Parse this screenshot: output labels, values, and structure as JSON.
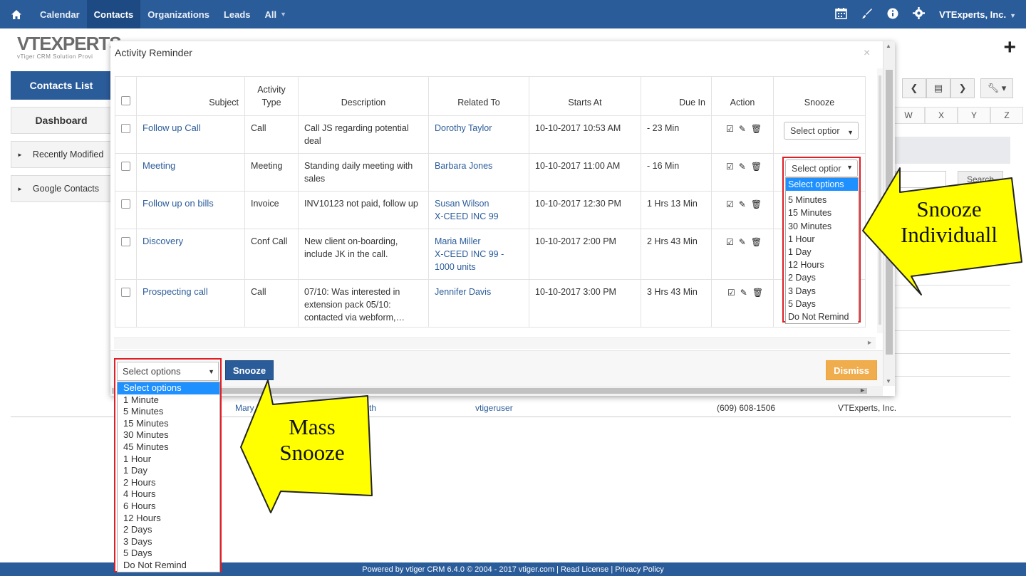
{
  "topnav": {
    "items": [
      "Calendar",
      "Contacts",
      "Organizations",
      "Leads",
      "All"
    ],
    "active": "Contacts",
    "company": "VTExperts, Inc.",
    "icons": [
      "home-icon",
      "calendar-icon",
      "brush-icon",
      "info-icon",
      "gear-icon"
    ]
  },
  "logo": {
    "main": "VTEXPERTS",
    "tagline": "vTiger CRM Solution Provi"
  },
  "sidebar": {
    "contacts_list": "Contacts List",
    "dashboard": "Dashboard",
    "recently_modified": "Recently Modified",
    "google_contacts": "Google Contacts"
  },
  "bg": {
    "alpha": [
      "W",
      "X",
      "Y",
      "Z"
    ],
    "search": "Search",
    "row": {
      "name": "Mary",
      "frag": "th",
      "owner": "vtigeruser",
      "phone": "(609) 608-1506",
      "org": "VTExperts, Inc."
    }
  },
  "modal": {
    "title": "Activity Reminder",
    "close": "×",
    "headers": [
      "Subject",
      "Activity Type",
      "Description",
      "Related To",
      "Starts At",
      "Due In",
      "Action",
      "Snooze"
    ],
    "rows": [
      {
        "subject": "Follow up Call",
        "type": "Call",
        "description": "Call JS regarding potential deal",
        "related": [
          "Dorothy Taylor"
        ],
        "starts": "10-10-2017 10:53 AM",
        "due": "- 23 Min",
        "overdue": true,
        "snooze": "Select optior"
      },
      {
        "subject": "Meeting",
        "type": "Meeting",
        "description": "Standing daily meeting with sales",
        "related": [
          "Barbara Jones"
        ],
        "starts": "10-10-2017 11:00 AM",
        "due": "- 16 Min",
        "overdue": true,
        "snooze": "Select optior"
      },
      {
        "subject": "Follow up on bills",
        "type": "Invoice",
        "description": "INV10123 not paid, follow up",
        "related": [
          "Susan Wilson",
          "X-CEED INC 99"
        ],
        "starts": "10-10-2017 12:30 PM",
        "due": "1 Hrs 13 Min",
        "overdue": false,
        "snooze": ""
      },
      {
        "subject": "Discovery",
        "type": "Conf Call",
        "description": "New client on-boarding, include JK in the call.",
        "related": [
          "Maria Miller",
          "X-CEED INC 99 - 1000 units"
        ],
        "starts": "10-10-2017 2:00 PM",
        "due": "2 Hrs 43 Min",
        "overdue": false,
        "snooze": ""
      },
      {
        "subject": "Prospecting call",
        "type": "Call",
        "description": "07/10: Was interested in extension pack 05/10: contacted via webform,…",
        "related": [
          "Jennifer Davis"
        ],
        "starts": "10-10-2017 3:00 PM",
        "due": "3 Hrs 43 Min",
        "overdue": false,
        "snooze": ""
      }
    ],
    "individual_options": [
      "Select options",
      "5 Minutes",
      "15 Minutes",
      "30 Minutes",
      "1 Hour",
      "1 Day",
      "12 Hours",
      "2 Days",
      "3 Days",
      "5 Days",
      "Do Not Remind"
    ],
    "mass_select_value": "Select options",
    "mass_options": [
      "Select options",
      "1 Minute",
      "5 Minutes",
      "15 Minutes",
      "30 Minutes",
      "45 Minutes",
      "1 Hour",
      "1 Day",
      "2 Hours",
      "4 Hours",
      "6 Hours",
      "12 Hours",
      "2 Days",
      "3 Days",
      "5 Days",
      "Do Not Remind"
    ],
    "snooze_button": "Snooze",
    "dismiss_button": "Dismiss"
  },
  "callouts": {
    "individual": [
      "Snooze",
      "Individuall"
    ],
    "mass": [
      "Mass",
      "Snooze"
    ]
  },
  "footer": "Powered by vtiger CRM 6.4.0  © 2004 - 2017  vtiger.com | Read License | Privacy Policy",
  "colors": {
    "nav": "#2b5c9a",
    "link": "#2b5c9a",
    "overdue": "#e53935",
    "dismiss": "#f0ad4e",
    "callout": "#ffff00",
    "highlight": "#e01e24"
  }
}
